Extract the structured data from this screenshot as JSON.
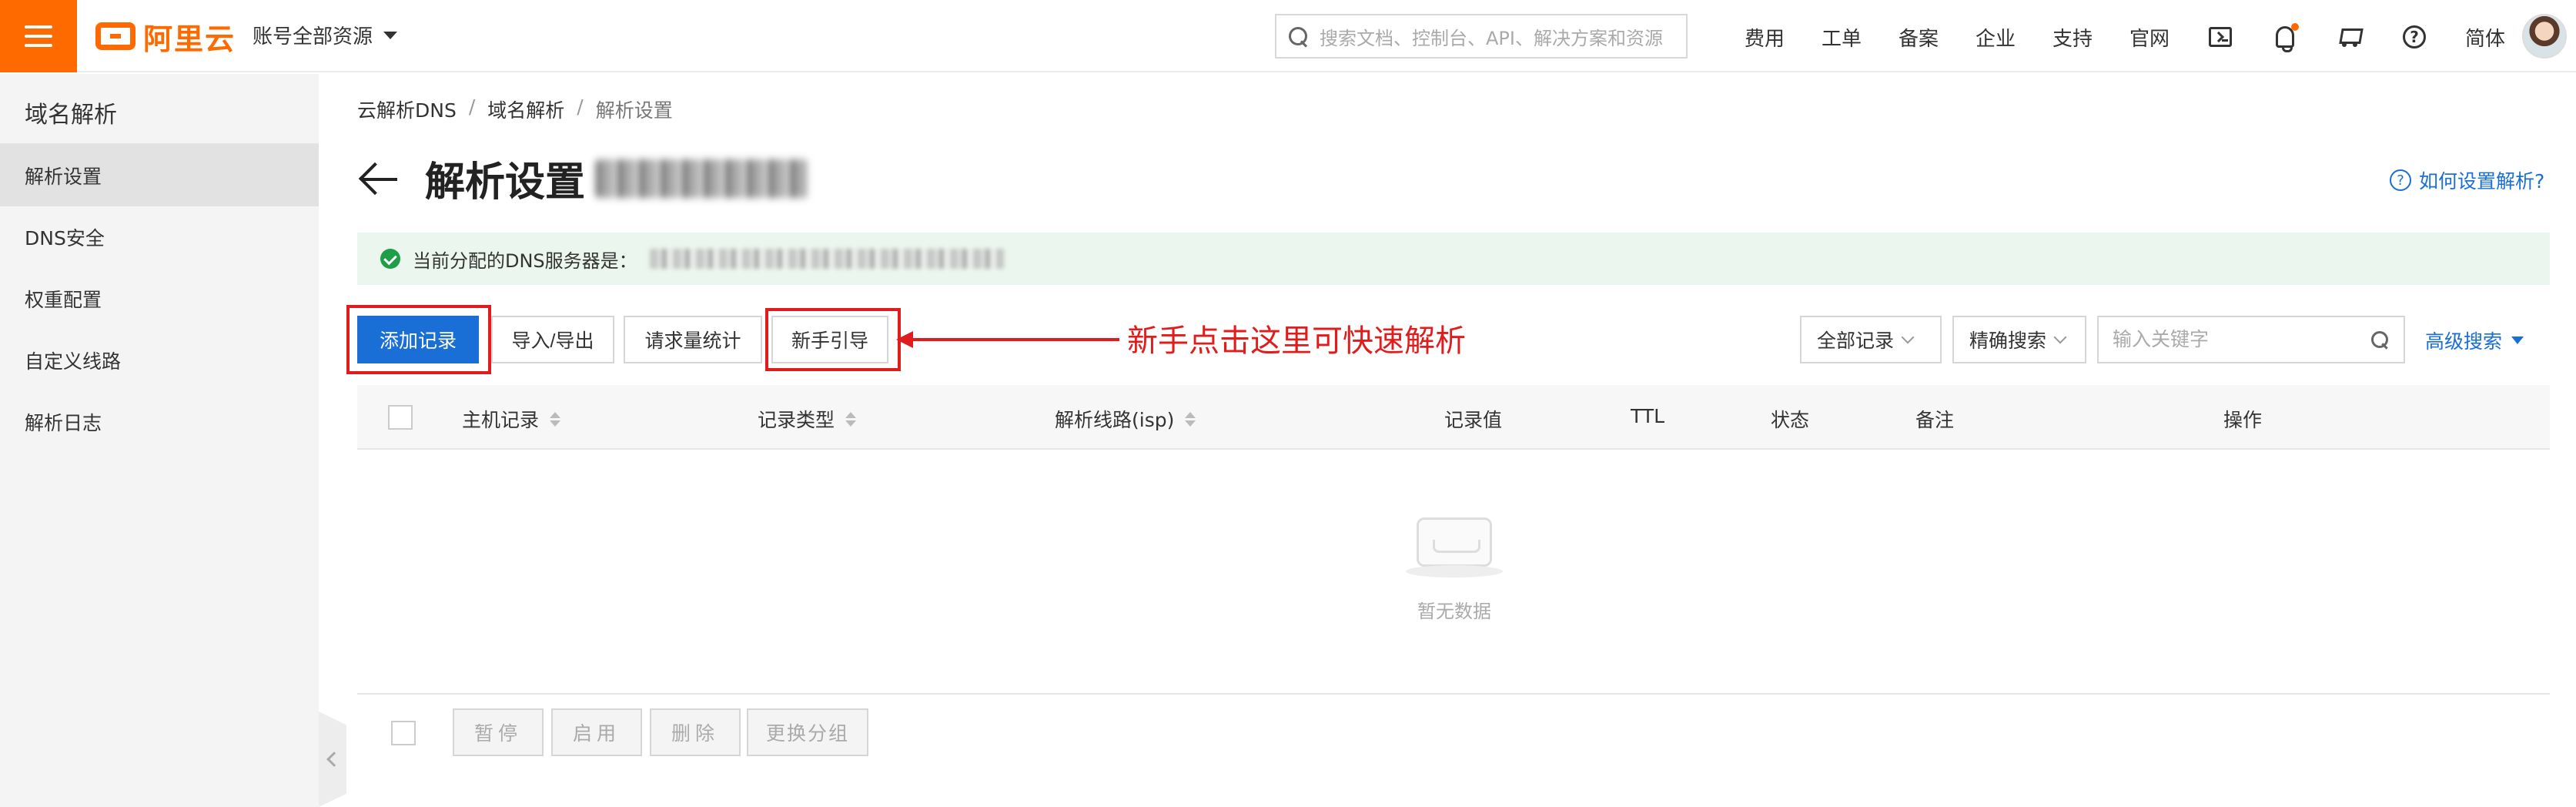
{
  "header": {
    "logo_text": "阿里云",
    "account_label": "账号全部资源",
    "search_placeholder": "搜索文档、控制台、API、解决方案和资源",
    "nav": [
      "费用",
      "工单",
      "备案",
      "企业",
      "支持",
      "官网"
    ],
    "language": "简体",
    "icons": [
      "terminal-icon",
      "bell-icon",
      "cart-icon",
      "help-icon"
    ],
    "accent_color": "#ff6a00"
  },
  "sidebar": {
    "title": "域名解析",
    "items": [
      {
        "label": "解析设置",
        "active": true
      },
      {
        "label": "DNS安全",
        "active": false
      },
      {
        "label": "权重配置",
        "active": false
      },
      {
        "label": "自定义线路",
        "active": false
      },
      {
        "label": "解析日志",
        "active": false
      }
    ]
  },
  "breadcrumb": [
    "云解析DNS",
    "域名解析",
    "解析设置"
  ],
  "page": {
    "title": "解析设置",
    "help_link": "如何设置解析?",
    "dns_notice": "当前分配的DNS服务器是："
  },
  "toolbar": {
    "add_record": "添加记录",
    "import_export": "导入/导出",
    "request_stats": "请求量统计",
    "guide": "新手引导",
    "annotation": "新手点击这里可快速解析",
    "all_records": "全部记录",
    "exact_search": "精确搜索",
    "keyword_placeholder": "输入关键字",
    "advanced_search": "高级搜索"
  },
  "table": {
    "columns": [
      "主机记录",
      "记录类型",
      "解析线路(isp)",
      "记录值",
      "TTL",
      "状态",
      "备注",
      "操作"
    ],
    "empty_text": "暂无数据"
  },
  "batch": {
    "pause": "暂停",
    "enable": "启用",
    "delete": "删除",
    "change_group": "更换分组"
  },
  "colors": {
    "primary": "#1a6fd6",
    "annotation": "#e01c1c",
    "success": "#1e9e46"
  }
}
